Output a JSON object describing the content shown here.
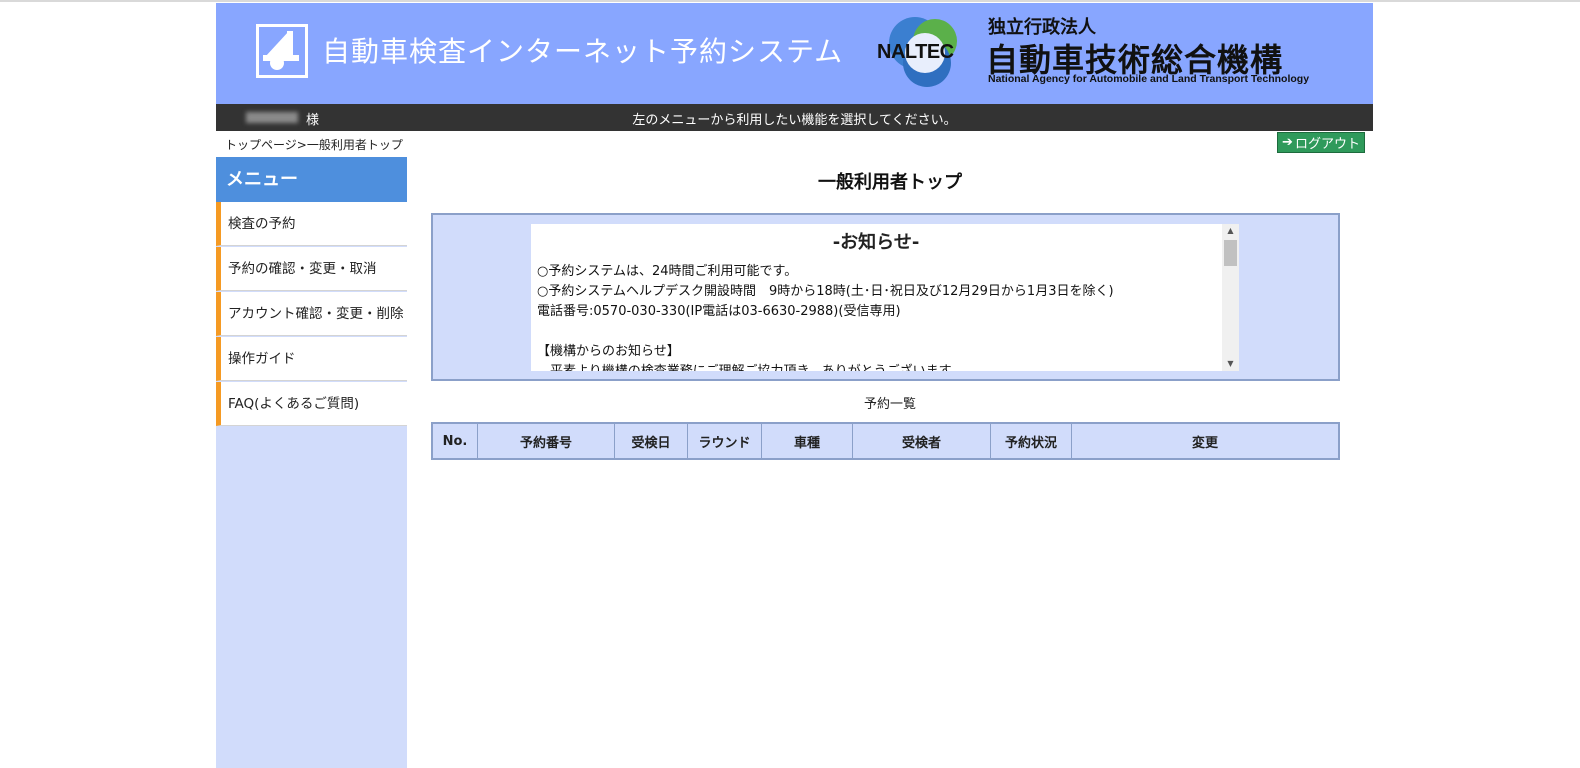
{
  "header": {
    "system_title": "自動車検査インターネット予約システム",
    "naltec_mark": "NALTEC",
    "org_type": "独立行政法人",
    "org_name": "自動車技術総合機構",
    "org_name_en": "National Agency for Automobile and Land Transport Technology"
  },
  "user_bar": {
    "user_suffix": "様",
    "message": "左のメニューから利用したい機能を選択してください。"
  },
  "breadcrumb": "トップページ>一般利用者トップ",
  "logout": {
    "label": "ログアウト",
    "icon": "arrow-right-icon"
  },
  "sidebar": {
    "heading": "メニュー",
    "items": [
      {
        "label": "検査の予約"
      },
      {
        "label": "予約の確認・変更・取消"
      },
      {
        "label": "アカウント確認・変更・削除"
      },
      {
        "label": "操作ガイド"
      },
      {
        "label": "FAQ(よくあるご質問)"
      }
    ]
  },
  "main": {
    "page_title": "一般利用者トップ",
    "notice": {
      "title": "-お知らせ-",
      "lines": [
        "○予約システムは、24時間ご利用可能です。",
        "○予約システムヘルプデスク開設時間　9時から18時(土･日･祝日及び12月29日から1月3日を除く)",
        "電話番号:0570-030-330(IP電話は03-6630-2988)(受信専用)",
        "",
        "【機構からのお知らせ】",
        "　平素より機構の検査業務にご理解ご協力頂き、ありがとうございます。"
      ]
    },
    "list_caption": "予約一覧",
    "table_headers": [
      "No.",
      "予約番号",
      "受検日",
      "ラウンド",
      "車種",
      "受検者",
      "予約状況",
      "変更"
    ]
  },
  "colors": {
    "header_bg": "#88a6ff",
    "user_bar_bg": "#333333",
    "menu_heading_bg": "#4e8fdd",
    "menu_accent": "#f59a23",
    "panel_bg": "#d1dcfb",
    "logout_bg": "#2f9a5b"
  }
}
